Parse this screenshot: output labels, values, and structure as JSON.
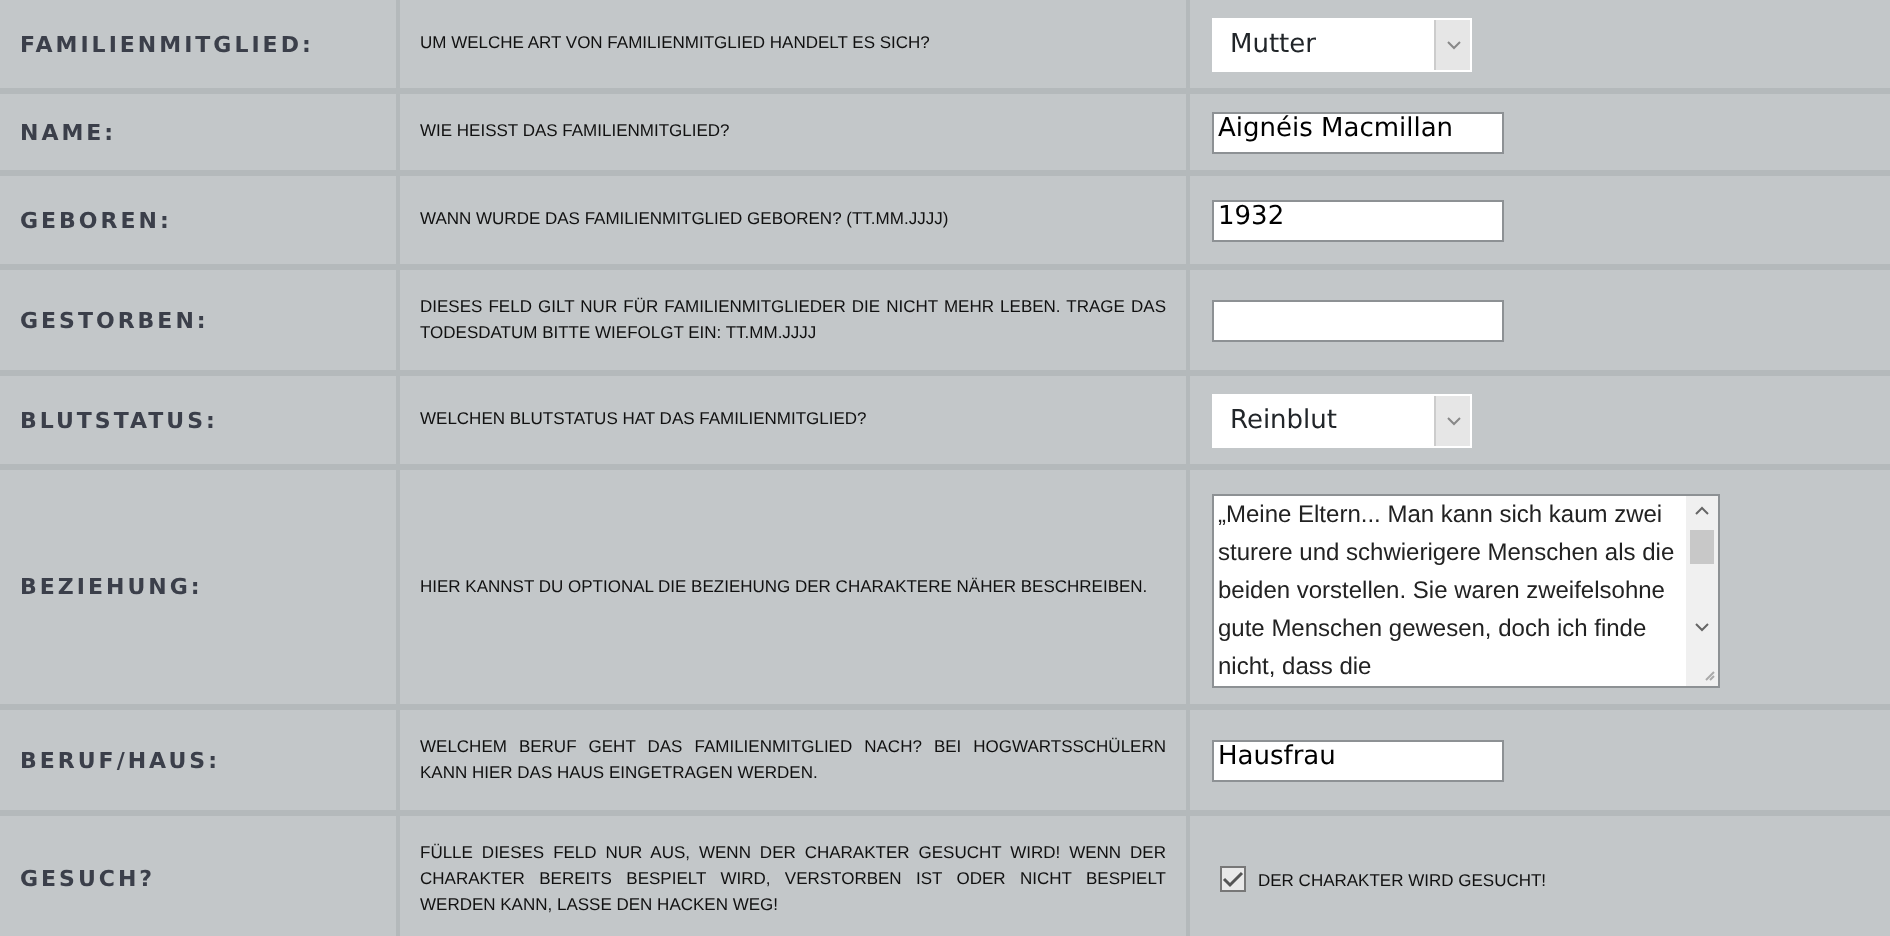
{
  "rows": [
    {
      "label": "FAMILIENMITGLIED:",
      "description": "UM WELCHE ART VON FAMILIENMITGLIED HANDELT ES SICH?",
      "field": {
        "kind": "select",
        "value": "Mutter"
      }
    },
    {
      "label": "NAME:",
      "description": "WIE HEISST DAS FAMILIENMITGLIED?",
      "field": {
        "kind": "text",
        "value": "Aignéis Macmillan"
      }
    },
    {
      "label": "GEBOREN:",
      "description": "WANN WURDE DAS FAMILIENMITGLIED GEBOREN? (TT.MM.JJJJ)",
      "field": {
        "kind": "text",
        "value": "1932"
      }
    },
    {
      "label": "GESTORBEN:",
      "description": "DIESES FELD GILT NUR FÜR FAMILIENMITGLIEDER DIE NICHT MEHR LEBEN. TRAGE DAS TODESDATUM BITTE WIEFOLGT EIN: TT.MM.JJJJ",
      "field": {
        "kind": "text"
      }
    },
    {
      "label": "BLUTSTATUS:",
      "description": "WELCHEN BLUTSTATUS HAT DAS FAMILIENMITGLIED?",
      "field": {
        "kind": "select",
        "value": "Reinblut"
      }
    },
    {
      "label": "BEZIEHUNG:",
      "description": "HIER KANNST DU OPTIONAL DIE BEZIEHUNG DER CHARAKTERE NÄHER BESCHREIBEN.",
      "field": {
        "kind": "textarea",
        "value": "„Meine Eltern... Man kann sich kaum zwei sturere und schwierigere Menschen als die beiden vorstellen. Sie waren zweifelsohne gute Menschen gewesen, doch ich finde nicht, dass die"
      }
    },
    {
      "label": "BERUF/HAUS:",
      "description": "WELCHEM BERUF GEHT DAS FAMILIENMITGLIED NACH? BEI HOGWARTSSCHÜLERN KANN HIER DAS HAUS EINGETRAGEN WERDEN.",
      "field": {
        "kind": "text",
        "value": "Hausfrau"
      }
    },
    {
      "label": "GESUCH?",
      "description": "FÜLLE DIESES FELD NUR AUS, WENN DER CHARAKTER GESUCHT WIRD! WENN DER CHARAKTER BEREITS BESPIELT WIRD, VERSTORBEN IST ODER NICHT BESPIELT WERDEN KANN, LASSE DEN HACKEN WEG!",
      "field": {
        "kind": "checkbox",
        "label": "DER CHARAKTER WIRD GESUCHT!",
        "checked": true
      }
    }
  ]
}
